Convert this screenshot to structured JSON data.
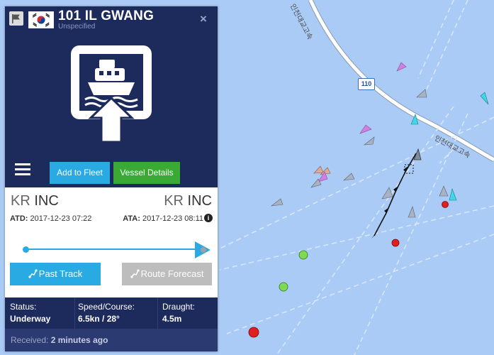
{
  "vessel": {
    "name": "101 IL GWANG",
    "type": "Unspecified",
    "close_label": "×",
    "flag_country": "KR"
  },
  "toolbar": {
    "add_to_fleet": "Add to Fleet",
    "vessel_details": "Vessel Details"
  },
  "voyage": {
    "departure_code": "KR",
    "departure_name": "INC",
    "arrival_code": "KR",
    "arrival_name": "INC",
    "atd_label": "ATD:",
    "atd_value": "2017-12-23 07:22",
    "ata_label": "ATA:",
    "ata_value": "2017-12-23 08:11",
    "info_icon": "i",
    "progress": 1.0
  },
  "actions": {
    "past_track": "Past Track",
    "route_forecast": "Route Forecast"
  },
  "stats": {
    "status_label": "Status:",
    "status_value": "Underway",
    "speed_label": "Speed/Course:",
    "speed_value": "6.5kn / 28°",
    "draught_label": "Draught:",
    "draught_value": "4.5m"
  },
  "received": {
    "label": "Received:",
    "value": "2 minutes ago"
  },
  "map": {
    "road_shield": "110",
    "road_label_1": "인천대교고속",
    "road_label_2": "인천대교고속"
  },
  "colors": {
    "panel_dark": "#1d2a5c",
    "accent_blue": "#29aae2",
    "accent_green": "#3aaa35",
    "disabled_gray": "#bdbdbd",
    "sea": "#aacbf5"
  },
  "icons": {
    "flag_toggle": "flag-icon",
    "hero": "ship-pictogram-icon",
    "menu": "hamburger-menu-icon",
    "track": "track-icon",
    "forecast": "route-icon",
    "info": "info-icon"
  }
}
